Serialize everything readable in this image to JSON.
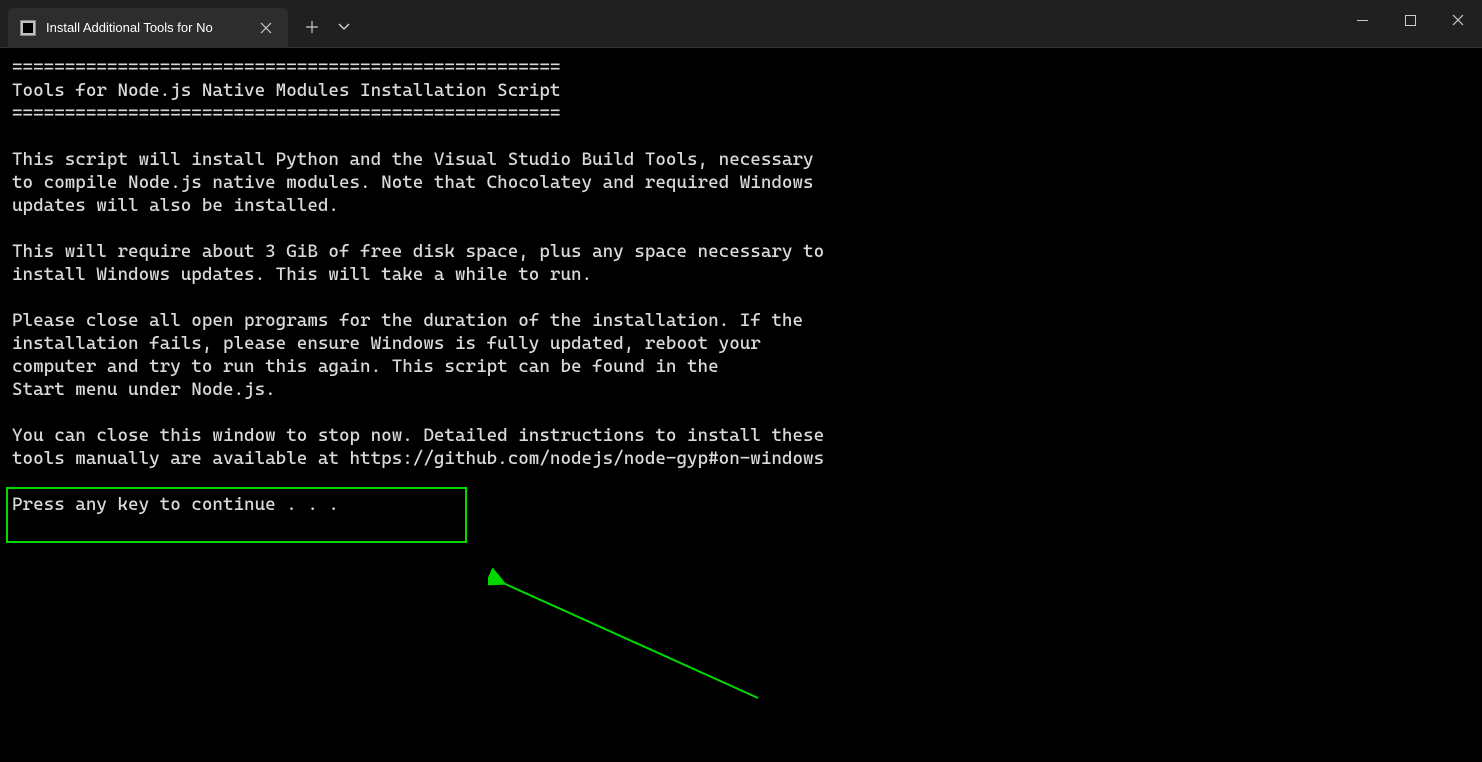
{
  "tab": {
    "title": "Install Additional Tools for No"
  },
  "terminal": {
    "line_divider_top": "====================================================",
    "title": "Tools for Node.js Native Modules Installation Script",
    "line_divider_bottom": "====================================================",
    "paragraph1": "This script will install Python and the Visual Studio Build Tools, necessary\nto compile Node.js native modules. Note that Chocolatey and required Windows\nupdates will also be installed.",
    "paragraph2": "This will require about 3 GiB of free disk space, plus any space necessary to\ninstall Windows updates. This will take a while to run.",
    "paragraph3": "Please close all open programs for the duration of the installation. If the\ninstallation fails, please ensure Windows is fully updated, reboot your\ncomputer and try to run this again. This script can be found in the\nStart menu under Node.js.",
    "paragraph4": "You can close this window to stop now. Detailed instructions to install these\ntools manually are available at https://github.com/nodejs/node-gyp#on-windows",
    "prompt": "Press any key to continue . . ."
  }
}
